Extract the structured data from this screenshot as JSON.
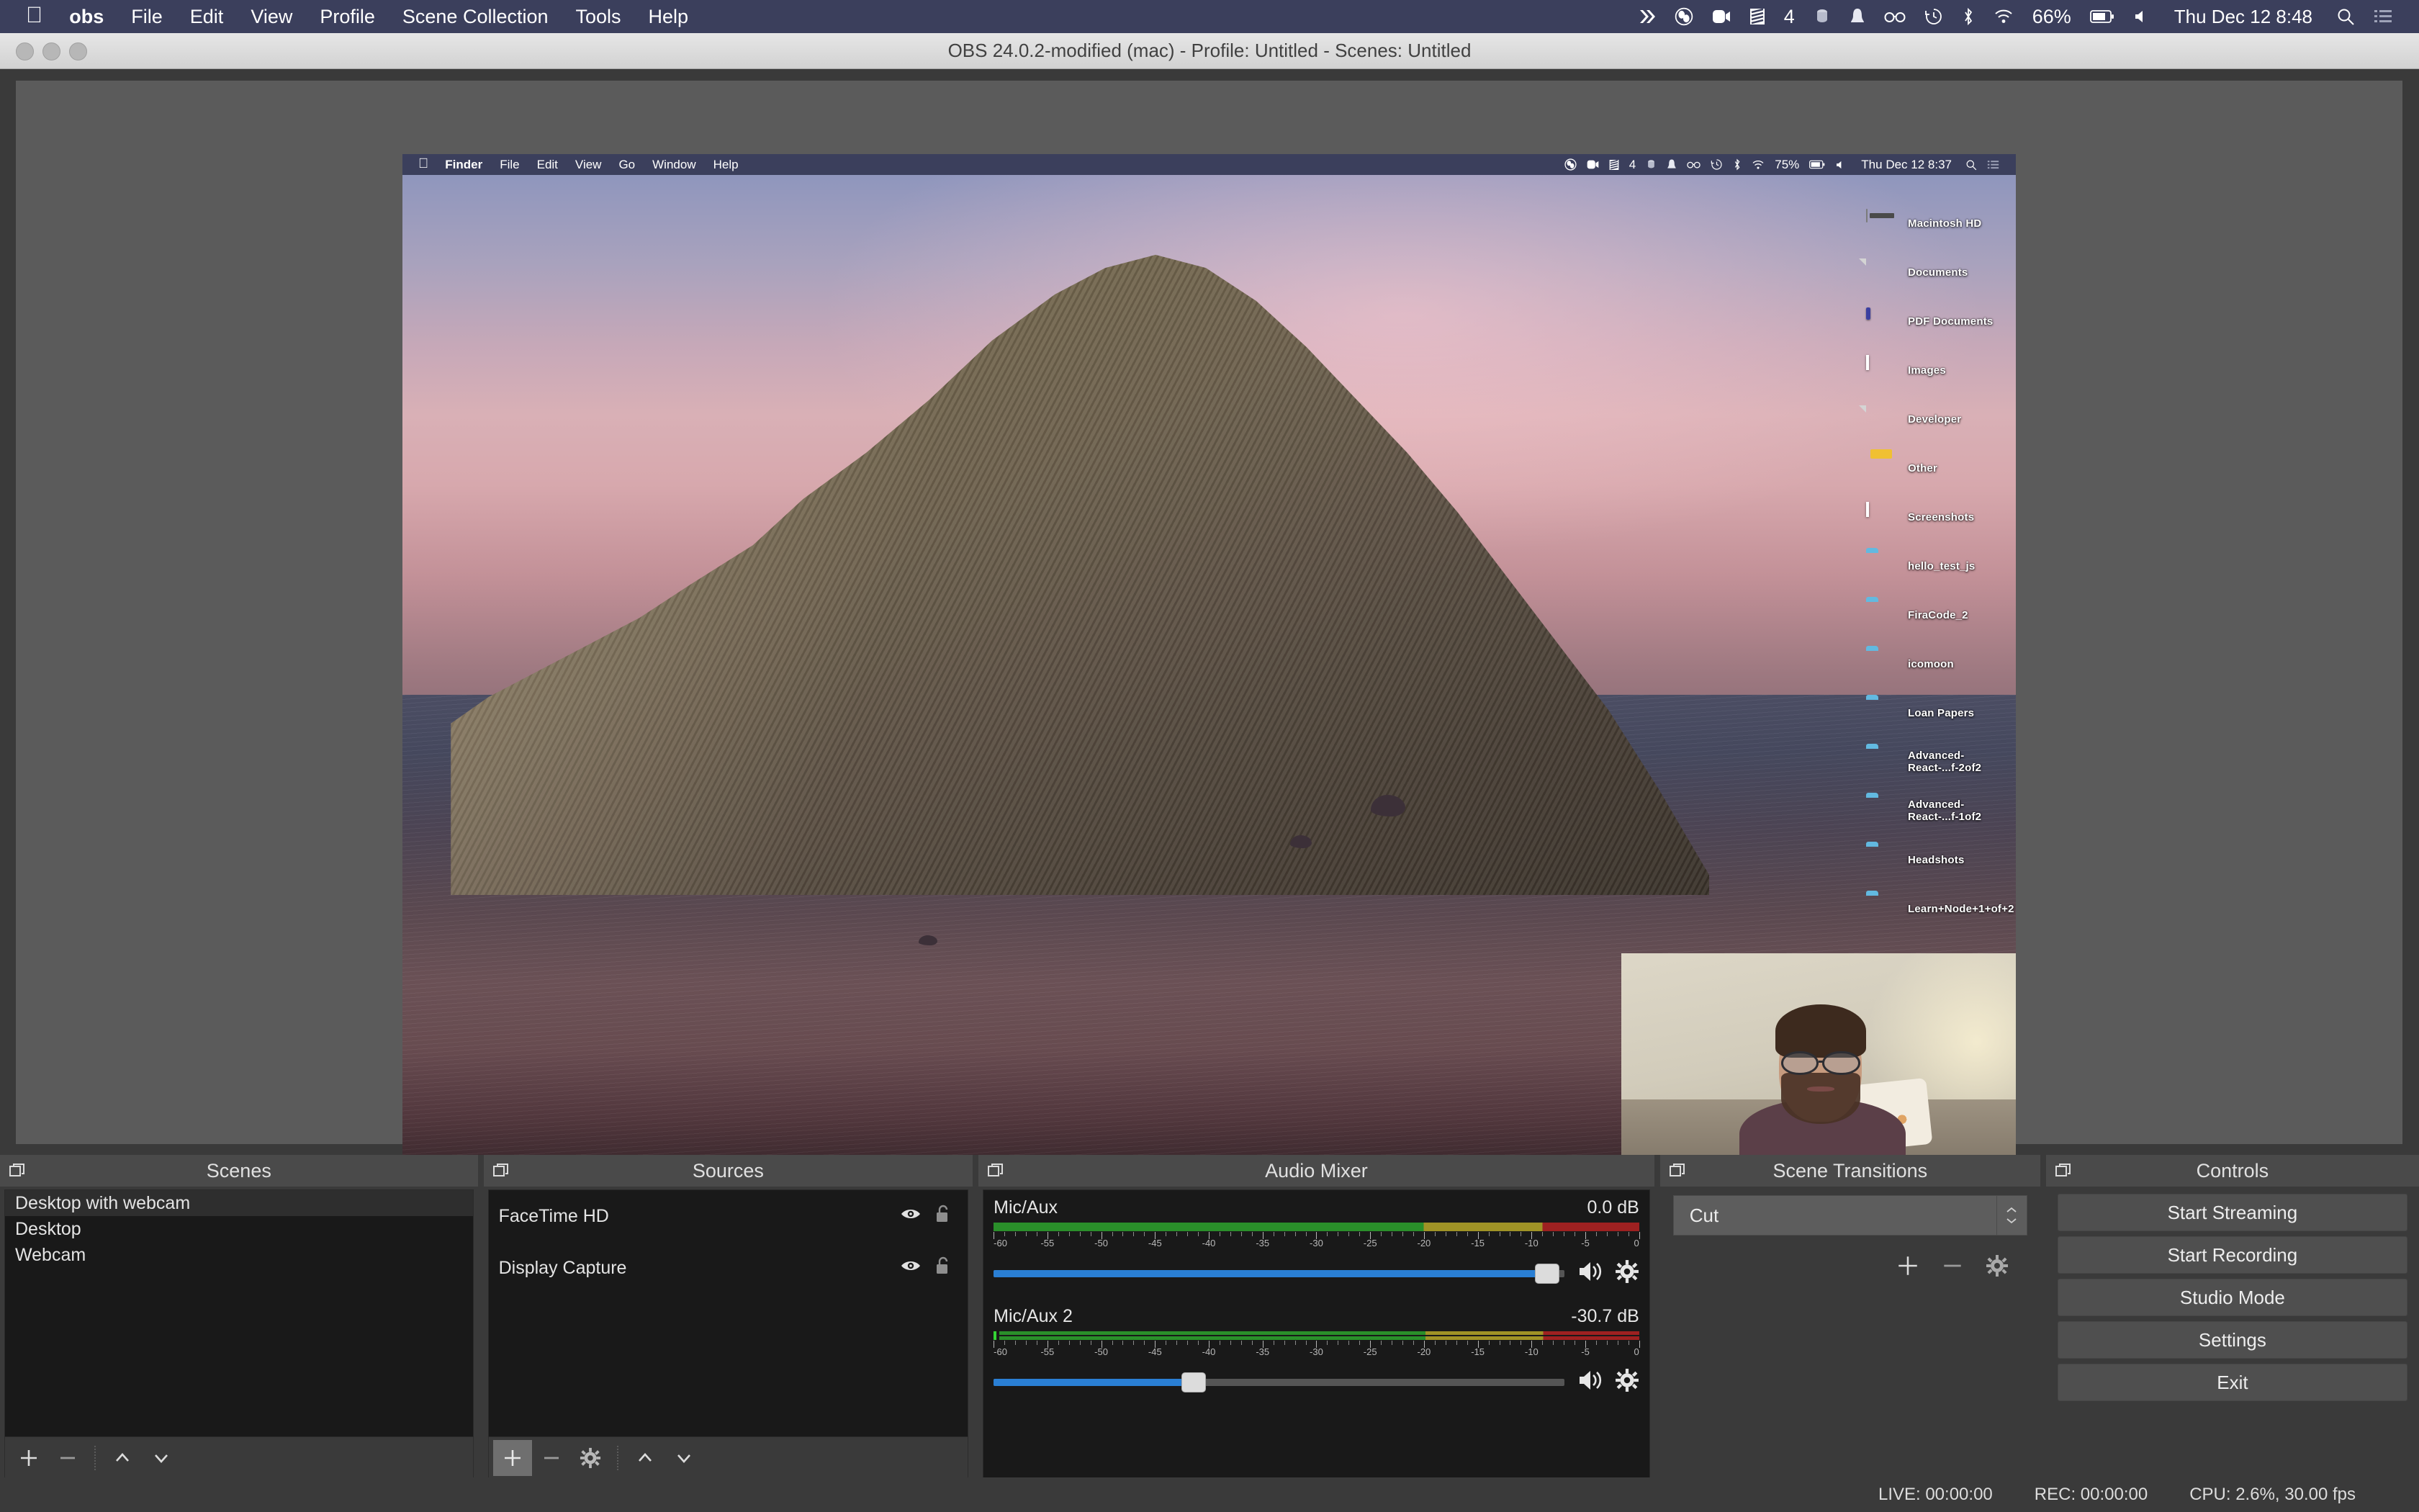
{
  "macbar": {
    "apple_icon": "apple-logo-icon",
    "menus": [
      {
        "label": "obs",
        "bold": true
      },
      {
        "label": "File",
        "bold": false
      },
      {
        "label": "Edit",
        "bold": false
      },
      {
        "label": "View",
        "bold": false
      },
      {
        "label": "Profile",
        "bold": false
      },
      {
        "label": "Scene Collection",
        "bold": false
      },
      {
        "label": "Tools",
        "bold": false
      },
      {
        "label": "Help",
        "bold": false
      }
    ],
    "status_icons": [
      "chevrons-right-icon",
      "obs-icon",
      "camera-icon",
      "shiftit-icon",
      "battery-counter-4",
      "dropbox-icon",
      "bell-icon",
      "glasses-icon",
      "timemachine-icon",
      "bluetooth-icon",
      "wifi-icon"
    ],
    "battery_percent": "66%",
    "clock": "Thu Dec 12  8:48",
    "search_icon": "search-icon",
    "control_center_icon": "list-icon"
  },
  "window": {
    "title": "OBS 24.0.2-modified (mac) - Profile: Untitled - Scenes: Untitled",
    "traffic_lights": [
      "close-button",
      "minimize-button",
      "zoom-button"
    ]
  },
  "preview": {
    "inner_menubar": {
      "apple_icon": "apple-logo-icon",
      "menus": [
        {
          "label": "Finder",
          "bold": true
        },
        {
          "label": "File",
          "bold": false
        },
        {
          "label": "Edit",
          "bold": false
        },
        {
          "label": "View",
          "bold": false
        },
        {
          "label": "Go",
          "bold": false
        },
        {
          "label": "Window",
          "bold": false
        },
        {
          "label": "Help",
          "bold": false
        }
      ],
      "status_icons": [
        "obs-icon",
        "camera-icon",
        "shiftit-icon",
        "badge-4",
        "dropbox-icon",
        "bell-icon",
        "glasses-icon",
        "timemachine-icon",
        "bluetooth-icon",
        "wifi-icon"
      ],
      "battery_percent": "75%",
      "clock": "Thu Dec 12  8:37",
      "search_icon": "search-icon",
      "control_center_icon": "list-icon"
    },
    "desktop_icons": [
      {
        "label": "Macintosh HD",
        "type": "harddrive-icon"
      },
      {
        "label": "Documents",
        "type": "text-document-icon"
      },
      {
        "label": "PDF Documents",
        "type": "pdf-document-icon"
      },
      {
        "label": "Images",
        "type": "image-document-icon"
      },
      {
        "label": "Developer",
        "type": "js-document-icon"
      },
      {
        "label": "Other",
        "type": "box-icon"
      },
      {
        "label": "Screenshots",
        "type": "image-document-icon"
      },
      {
        "label": "hello_test_js",
        "type": "folder-icon"
      },
      {
        "label": "FiraCode_2",
        "type": "folder-icon"
      },
      {
        "label": "icomoon",
        "type": "folder-icon"
      },
      {
        "label": "Loan Papers",
        "type": "folder-icon"
      },
      {
        "label": "Advanced-React-...f-2of2",
        "type": "folder-icon"
      },
      {
        "label": "Advanced-React-...f-1of2",
        "type": "folder-icon"
      },
      {
        "label": "Headshots",
        "type": "folder-icon"
      },
      {
        "label": "Learn+Node+1+of+2",
        "type": "folder-icon"
      }
    ]
  },
  "scenes": {
    "title": "Scenes",
    "items": [
      {
        "label": "Desktop with webcam",
        "selected": true
      },
      {
        "label": "Desktop",
        "selected": false
      },
      {
        "label": "Webcam",
        "selected": false
      }
    ],
    "toolbar": [
      "add-scene-button",
      "remove-scene-button",
      "move-scene-up-button",
      "move-scene-down-button"
    ]
  },
  "sources": {
    "title": "Sources",
    "items": [
      {
        "label": "FaceTime HD",
        "visible": true,
        "locked": false
      },
      {
        "label": "Display Capture",
        "visible": true,
        "locked": false
      }
    ],
    "toolbar": [
      "add-source-button",
      "remove-source-button",
      "source-properties-button",
      "move-source-up-button",
      "move-source-down-button"
    ]
  },
  "audio_mixer": {
    "title": "Audio Mixer",
    "tick_labels": [
      "-60",
      "-55",
      "-50",
      "-45",
      "-40",
      "-35",
      "-30",
      "-25",
      "-20",
      "-15",
      "-10",
      "-5",
      "0"
    ],
    "tracks": [
      {
        "name": "Mic/Aux",
        "db": "0.0 dB",
        "volume_percent": 97,
        "meter_level_percent": 100,
        "dual_meter": false,
        "mute_icon": "speaker-on-icon",
        "settings_icon": "gear-icon"
      },
      {
        "name": "Mic/Aux 2",
        "db": "-30.7 dB",
        "volume_percent": 35,
        "meter_level_percent": 100,
        "dual_meter": true,
        "mute_icon": "speaker-on-icon",
        "settings_icon": "gear-icon"
      }
    ]
  },
  "scene_transitions": {
    "title": "Scene Transitions",
    "selected": "Cut",
    "buttons": [
      "add-transition-button",
      "remove-transition-button",
      "transition-properties-button"
    ]
  },
  "controls": {
    "title": "Controls",
    "buttons": [
      {
        "label": "Start Streaming",
        "name": "start-streaming-button"
      },
      {
        "label": "Start Recording",
        "name": "start-recording-button"
      },
      {
        "label": "Studio Mode",
        "name": "studio-mode-button"
      },
      {
        "label": "Settings",
        "name": "settings-button"
      },
      {
        "label": "Exit",
        "name": "exit-button"
      }
    ]
  },
  "status_bar": {
    "live": "LIVE: 00:00:00",
    "rec": "REC: 00:00:00",
    "cpu": "CPU: 2.6%, 30.00 fps"
  },
  "colors": {
    "menubar_bg": "#3b3f5c",
    "panel_header": "#4a4a4a",
    "panel_bg": "#3a3a3a",
    "list_bg": "#191919",
    "slider_blue": "#2a7fd4",
    "meter_green": "#2a8f2a",
    "meter_yellow": "#a09326",
    "meter_red": "#9e2121"
  }
}
